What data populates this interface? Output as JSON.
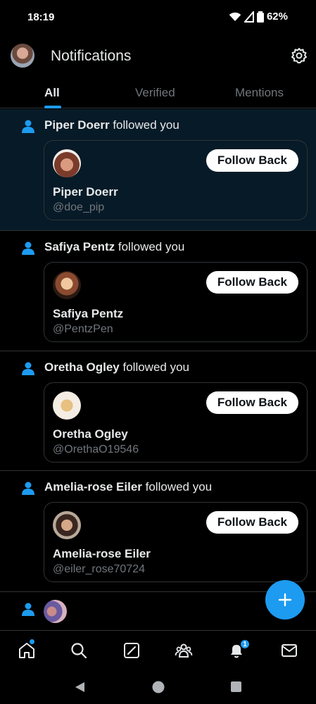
{
  "status_bar": {
    "time": "18:19",
    "battery": "62%"
  },
  "header": {
    "title": "Notifications"
  },
  "tabs": [
    {
      "label": "All",
      "active": true
    },
    {
      "label": "Verified",
      "active": false
    },
    {
      "label": "Mentions",
      "active": false
    }
  ],
  "notifications": [
    {
      "name": "Piper Doerr",
      "action": " followed you",
      "handle": "@doe_pip",
      "button": "Follow Back"
    },
    {
      "name": "Safiya Pentz",
      "action": " followed you",
      "handle": "@PentzPen",
      "button": "Follow Back"
    },
    {
      "name": "Oretha Ogley",
      "action": " followed you",
      "handle": "@OrethaO19546",
      "button": "Follow Back"
    },
    {
      "name": "Amelia-rose Eiler",
      "action": " followed you",
      "handle": "@eiler_rose70724",
      "button": "Follow Back"
    }
  ],
  "bottom_nav": {
    "items": [
      "home-icon",
      "search-icon",
      "grok-icon",
      "communities-icon",
      "notifications-icon",
      "messages-icon"
    ],
    "notification_count": "1"
  },
  "colors": {
    "accent": "#1d9bf0",
    "highlight_bg": "#071a27",
    "border": "#2f3336",
    "muted": "#71767b"
  }
}
